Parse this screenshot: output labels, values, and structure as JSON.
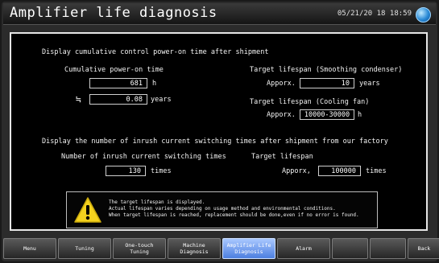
{
  "window": {
    "title": "Amplifier life diagnosis",
    "clock": "05/21/20 18 18:59"
  },
  "section1": {
    "heading": "Display cumulative control power-on time after shipment",
    "power_on_label": "Cumulative power-on time",
    "power_on_value": "681",
    "power_on_unit": "h",
    "approx_symbol": "≒",
    "years_value": "0.08",
    "years_unit": "years",
    "target_condenser_label": "Target lifespan (Smoothing condenser)",
    "approx_label": "Apporx.",
    "condenser_value": "10",
    "condenser_unit": "years",
    "target_fan_label": "Target lifespan (Cooling fan)",
    "fan_approx_label": "Apporx.",
    "fan_value": "10000-30000",
    "fan_unit": "h"
  },
  "section2": {
    "heading": "Display the number of inrush current switching times after shipment from our factory",
    "count_label": "Number of inrush current switching times",
    "count_value": "130",
    "count_unit": "times",
    "target_label": "Target lifespan",
    "approx_label": "Apporx,",
    "target_value": "100000",
    "target_unit": "times"
  },
  "notice": {
    "icon": "warning-icon",
    "line1": "The target lifespan is displayed.",
    "line2": "Actual lifespan varies depending on usage method and environmental conditions.",
    "line3": "When target lifespan is reached, replacement should be done,even if no error is found."
  },
  "nav": {
    "menu": "Menu",
    "tuning": "Tuning",
    "one_touch": "One-touch\nTuning",
    "machine": "Machine\nDiagnosis",
    "amplifier": "Amplifier Life\nDiagnosis",
    "alarm": "Alarm",
    "blank1": "",
    "blank2": "",
    "back": "Back"
  },
  "colors": {
    "accent": "#4d7fe0",
    "panel_border": "#e6e6e6",
    "warning": "#f4d21e"
  }
}
